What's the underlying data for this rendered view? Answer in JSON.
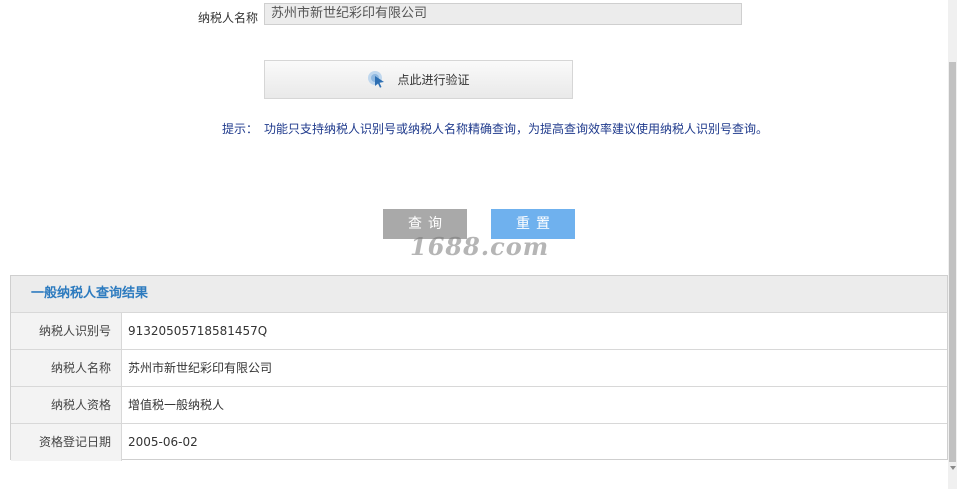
{
  "form": {
    "taxpayer_name_label": "纳税人名称",
    "taxpayer_name_value": "苏州市新世纪彩印有限公司",
    "verify_button_label": "点此进行验证",
    "hint_label": "提示：",
    "hint_text": "功能只支持纳税人识别号或纳税人名称精确查询，为提高查询效率建议使用纳税人识别号查询。",
    "query_button": "查询",
    "reset_button": "重置"
  },
  "watermark": "1688.com",
  "result": {
    "title": "一般纳税人查询结果",
    "rows": [
      {
        "label": "纳税人识别号",
        "value": "91320505718581457Q"
      },
      {
        "label": "纳税人名称",
        "value": "苏州市新世纪彩印有限公司"
      },
      {
        "label": "纳税人资格",
        "value": "增值税一般纳税人"
      },
      {
        "label": "资格登记日期",
        "value": "2005-06-02"
      }
    ]
  },
  "colors": {
    "accent": "#2d7bbf",
    "reset_button": "#6fb1ee",
    "query_button": "#a9a9a9",
    "hint": "#1f3a8c"
  }
}
